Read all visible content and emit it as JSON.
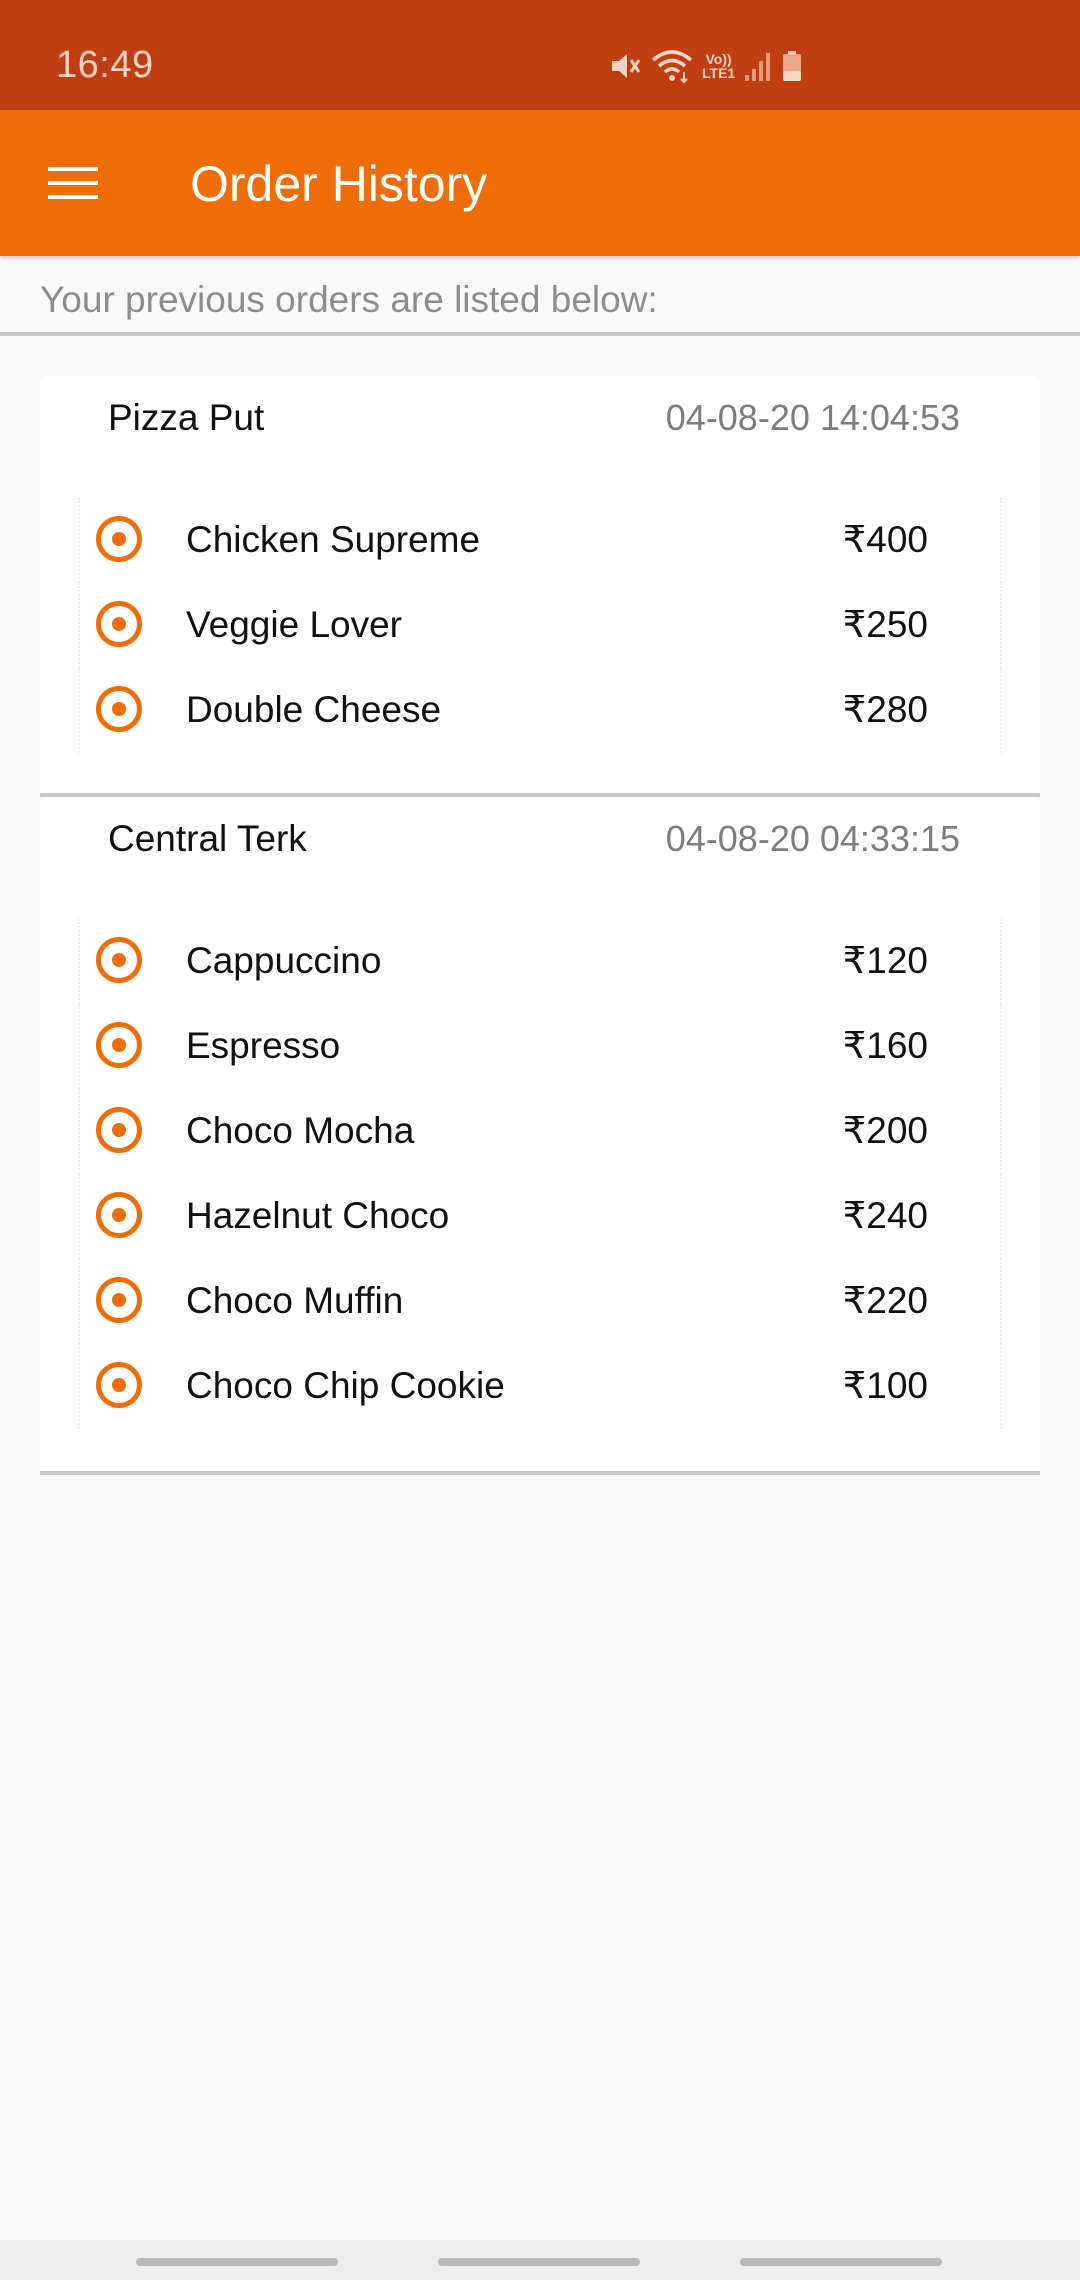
{
  "status_bar": {
    "time": "16:49",
    "icons": [
      "mute-icon",
      "wifi-icon",
      "volte-lte-icon",
      "signal-icon",
      "battery-icon"
    ],
    "lte_label": "Vo))\nLTE1"
  },
  "app_bar": {
    "title": "Order History",
    "menu_icon": "hamburger-menu-icon"
  },
  "subtitle": "Your previous orders are listed below:",
  "orders": [
    {
      "restaurant": "Pizza Put",
      "datetime": "04-08-20 14:04:53",
      "items": [
        {
          "name": "Chicken Supreme",
          "price": "₹400"
        },
        {
          "name": "Veggie Lover",
          "price": "₹250"
        },
        {
          "name": "Double Cheese",
          "price": "₹280"
        }
      ]
    },
    {
      "restaurant": "Central Terk",
      "datetime": "04-08-20 04:33:15",
      "items": [
        {
          "name": "Cappuccino",
          "price": "₹120"
        },
        {
          "name": "Espresso",
          "price": "₹160"
        },
        {
          "name": "Choco Mocha",
          "price": "₹200"
        },
        {
          "name": "Hazelnut Choco",
          "price": "₹240"
        },
        {
          "name": "Choco Muffin",
          "price": "₹220"
        },
        {
          "name": "Choco Chip Cookie",
          "price": "₹100"
        }
      ]
    }
  ],
  "colors": {
    "status_bar": "#c13d12",
    "app_bar": "#ee6d07",
    "accent": "#ee6d07",
    "background": "#f9f9f9"
  }
}
